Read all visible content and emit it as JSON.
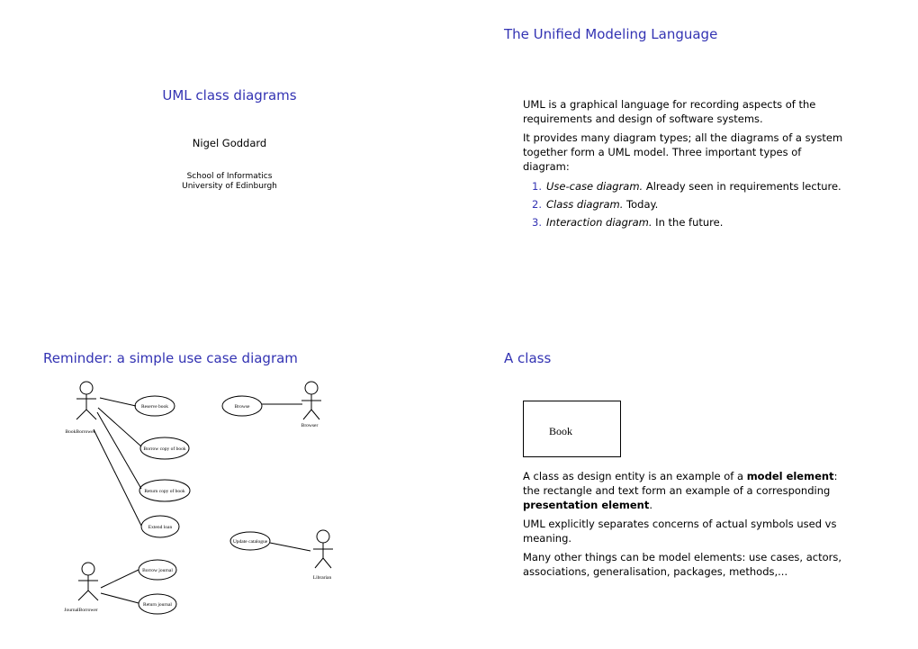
{
  "slide1": {
    "title": "UML class diagrams",
    "author": "Nigel Goddard",
    "affiliation_line1": "School of Informatics",
    "affiliation_line2": "University of Edinburgh"
  },
  "slide2": {
    "title": "The Unified Modeling Language",
    "para1": "UML is a graphical language for recording aspects of the requirements and design of software systems.",
    "para2": "It provides many diagram types; all the diagrams of a system together form a UML model. Three important types of diagram:",
    "items": [
      {
        "num": "1.",
        "name": "Use-case diagram.",
        "text": " Already seen in requirements lecture."
      },
      {
        "num": "2.",
        "name": "Class diagram.",
        "text": " Today."
      },
      {
        "num": "3.",
        "name": "Interaction diagram.",
        "text": " In the future."
      }
    ]
  },
  "slide3": {
    "title": "Reminder: a simple use case diagram",
    "actors": [
      "BookBorrower",
      "Browser",
      "Librarian",
      "JournalBorrower"
    ],
    "use_cases": [
      "Reserve book",
      "Browse",
      "Borrow copy of book",
      "Return copy of book",
      "Extend loan",
      "Update catalogue",
      "Borrow journal",
      "Return journal"
    ]
  },
  "slide4": {
    "title": "A class",
    "class_name": "Book",
    "p1_a": "A class as design entity is an example of a ",
    "p1_b": "model element",
    "p1_c": ": the rectangle and text form an example of a corresponding ",
    "p1_d": "presentation element",
    "p1_e": ".",
    "p2": "UML explicitly separates concerns of actual symbols used vs meaning.",
    "p3": "Many other things can be model elements: use cases, actors, associations, generalisation, packages, methods,..."
  },
  "colors": {
    "title": "#3333b3"
  }
}
